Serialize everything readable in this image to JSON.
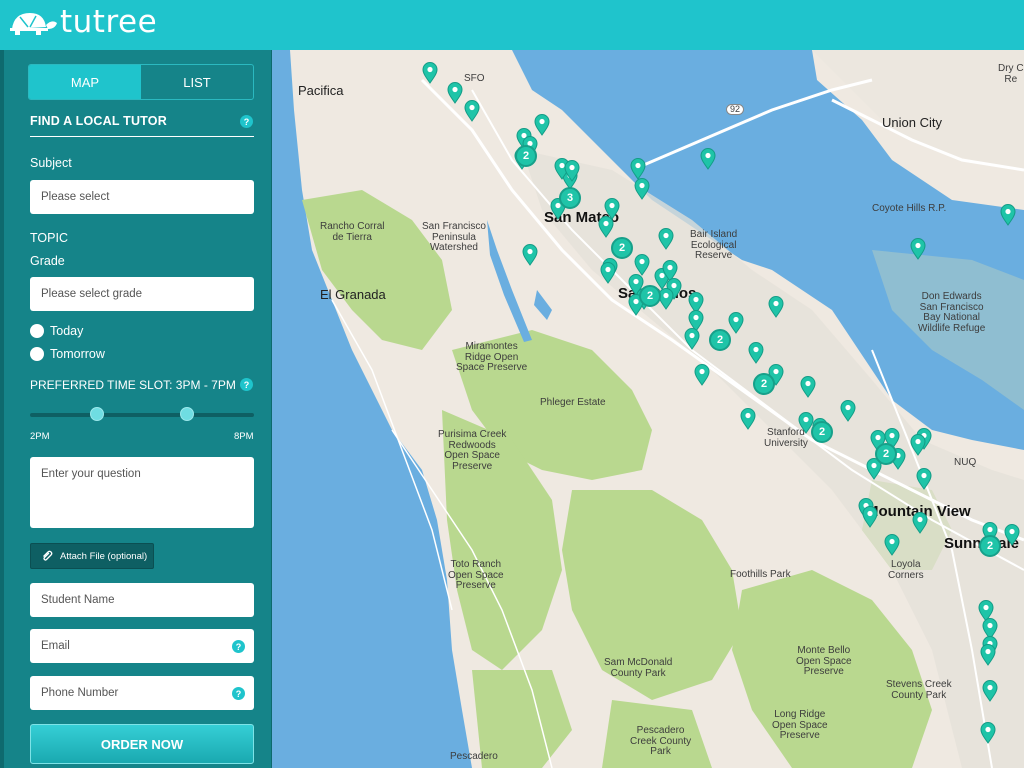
{
  "brand": {
    "name": "tutree"
  },
  "tabs": {
    "map": "MAP",
    "list": "LIST"
  },
  "form": {
    "section_title": "FIND A LOCAL TUTOR",
    "subject_label": "Subject",
    "subject_placeholder": "Please select",
    "topic_label": "TOPIC",
    "grade_label": "Grade",
    "grade_placeholder": "Please select grade",
    "today_label": "Today",
    "tomorrow_label": "Tomorrow",
    "time_slot_label": "PREFERRED TIME SLOT: 3PM - 7PM",
    "slider_min": "2PM",
    "slider_max": "8PM",
    "slider_range": [
      0.3,
      0.7
    ],
    "question_placeholder": "Enter your question",
    "attach_label": "Attach File (optional)",
    "student_name_placeholder": "Student Name",
    "email_placeholder": "Email",
    "phone_placeholder": "Phone Number",
    "order_label": "ORDER NOW"
  },
  "map": {
    "places": {
      "pacifica": "Pacifica",
      "sfo": "SFO",
      "union_city": "Union City",
      "dry_creek": "Dry C\nRe",
      "route_92": "92",
      "san_mateo": "San Mateo",
      "rancho_corral": "Rancho Corral\nde Tierra",
      "sf_watershed": "San Francisco\nPeninsula\nWatershed",
      "bair_island": "Bair Island\nEcological\nReserve",
      "coyote_hills": "Coyote Hills R.P.",
      "el_granada": "El Granada",
      "san_carlos": "San Carlos",
      "don_edwards": "Don Edwards\nSan Francisco\nBay National\nWildlife Refuge",
      "miramontes": "Miramontes\nRidge Open\nSpace Preserve",
      "phleger": "Phleger Estate",
      "stanford": "Stanford\nUniversity",
      "purisima": "Purisima Creek\nRedwoods\nOpen Space\nPreserve",
      "nuq": "NUQ",
      "mountain_view": "Mountain View",
      "sunnyvale": "Sunnyvale",
      "toto_ranch": "Toto Ranch\nOpen Space\nPreserve",
      "foothills": "Foothills Park",
      "loyola": "Loyola\nCorners",
      "sam_mcdonald": "Sam McDonald\nCounty Park",
      "monte_bello": "Monte Bello\nOpen Space\nPreserve",
      "stevens_creek": "Stevens Creek\nCounty Park",
      "long_ridge": "Long Ridge\nOpen Space\nPreserve",
      "pescadero_park": "Pescadero\nCreek County\nPark",
      "pescadero": "Pescadero"
    },
    "clusters": [
      "2",
      "3",
      "2",
      "2",
      "2",
      "2",
      "2",
      "2",
      "2"
    ]
  },
  "colors": {
    "header": "#1fc4cc",
    "sidebar": "#158489",
    "pin": "#1fc4a8",
    "water": "#6aaee0"
  }
}
